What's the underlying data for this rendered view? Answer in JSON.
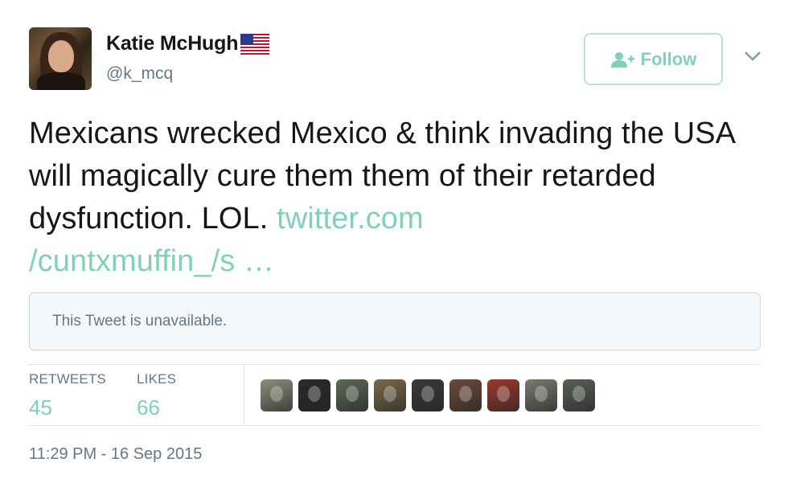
{
  "user": {
    "name": "Katie McHugh",
    "handle": "@k_mcq",
    "flag_icon": "us-flag-icon",
    "avatar_icon": "profile-photo"
  },
  "follow": {
    "label": "Follow",
    "icon": "add-user-icon",
    "accent": "#7fd1b9"
  },
  "menu": {
    "icon": "chevron-down-icon"
  },
  "tweet": {
    "text": "Mexicans wrecked Mexico & think invading the USA will magically cure them them of their retarded dysfunction. LOL. ",
    "link_line1": "twitter.com",
    "link_line2": "/cuntxmuffin_/s …"
  },
  "quoted": {
    "text": "This Tweet is unavailable."
  },
  "stats": {
    "retweets_label": "RETWEETS",
    "retweets_value": "45",
    "likes_label": "LIKES",
    "likes_value": "66"
  },
  "likers": [
    {
      "color": "#8a8f7a"
    },
    {
      "color": "#2a2a2a"
    },
    {
      "color": "#5c6a58"
    },
    {
      "color": "#7a6a48"
    },
    {
      "color": "#3a3a3a"
    },
    {
      "color": "#6b4a3a"
    },
    {
      "color": "#9a3a2a"
    },
    {
      "color": "#7a7a72"
    },
    {
      "color": "#5a6058"
    }
  ],
  "timestamp": "11:29 PM - 16 Sep 2015"
}
